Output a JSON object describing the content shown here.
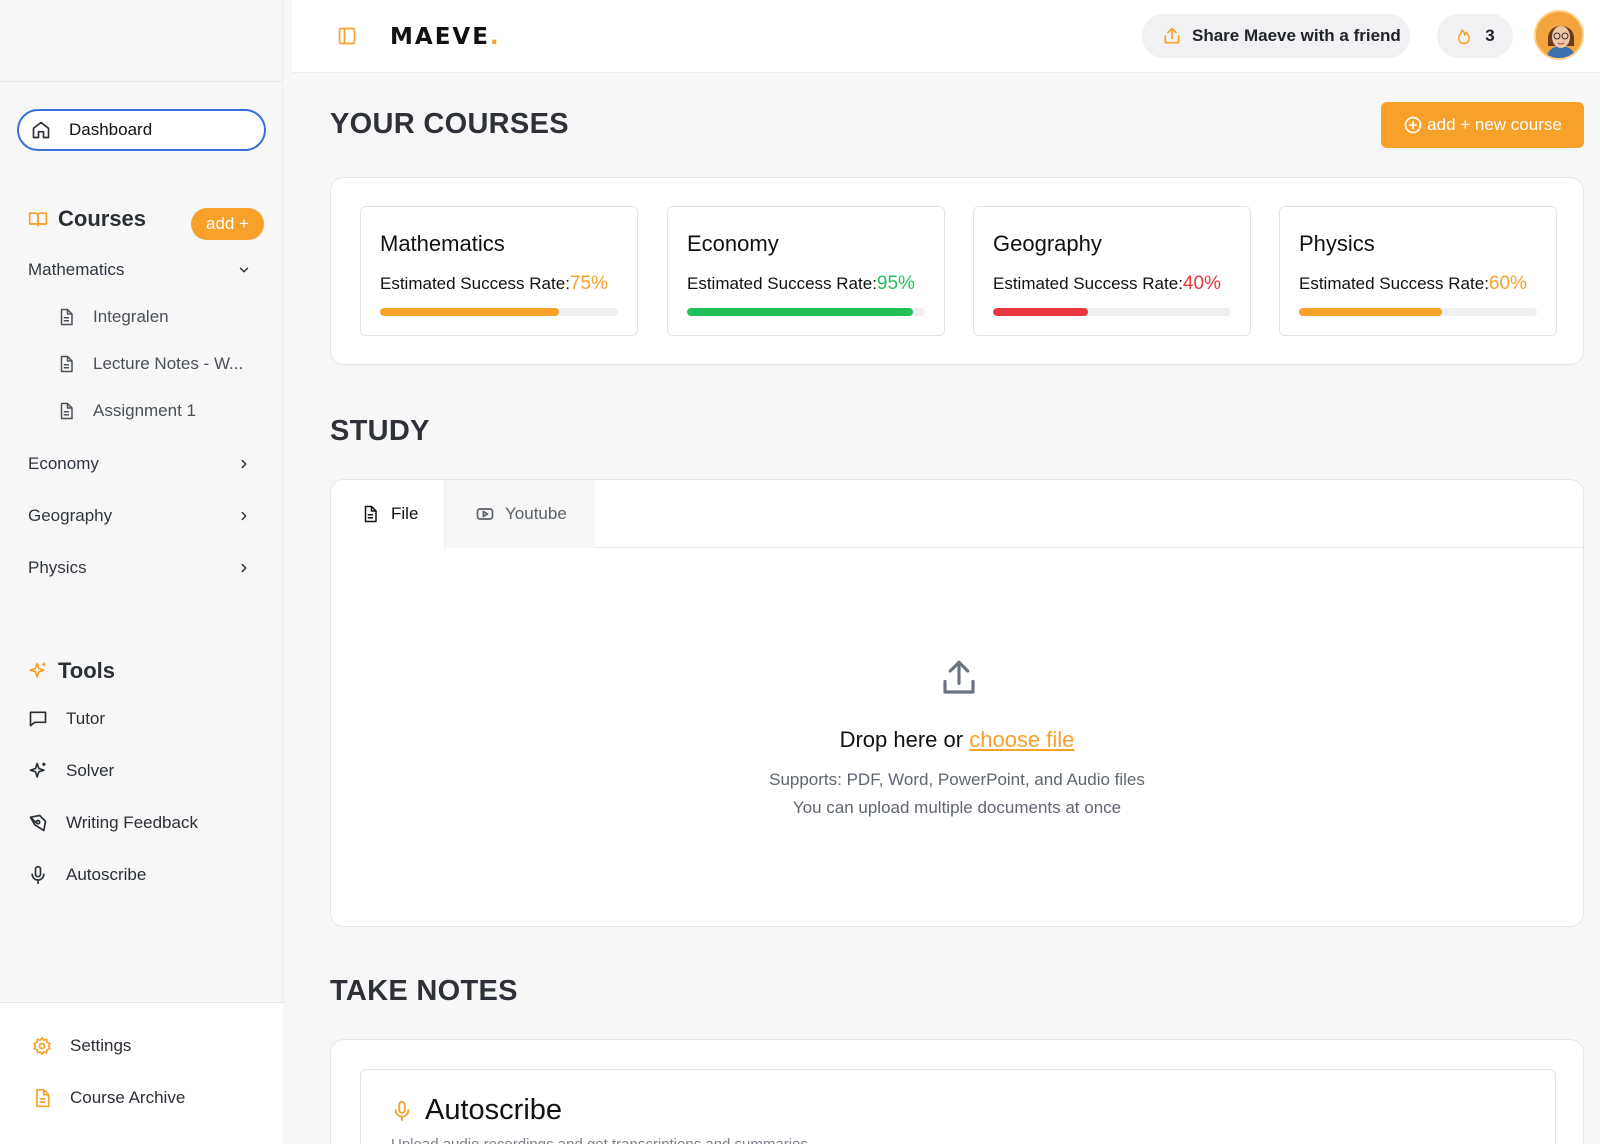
{
  "brand": {
    "name": "MAEVE",
    "dot": ".",
    "accent": "#f7a02a"
  },
  "topbar": {
    "share_label": "Share Maeve with a friend",
    "streak_count": "3"
  },
  "sidebar": {
    "dashboard_label": "Dashboard",
    "courses_heading": "Courses",
    "add_label": "add +",
    "courses": [
      {
        "label": "Mathematics",
        "expanded": true,
        "items": [
          "Integralen",
          "Lecture Notes - W...",
          "Assignment 1"
        ]
      },
      {
        "label": "Economy",
        "expanded": false
      },
      {
        "label": "Geography",
        "expanded": false
      },
      {
        "label": "Physics",
        "expanded": false
      }
    ],
    "tools_heading": "Tools",
    "tools": [
      "Tutor",
      "Solver",
      "Writing Feedback",
      "Autoscribe"
    ],
    "bottom": [
      "Settings",
      "Course Archive"
    ]
  },
  "main": {
    "courses_title": "YOUR COURSES",
    "new_course_label": "add + new course",
    "course_cards": [
      {
        "title": "Mathematics",
        "rate_label": "Estimated Success Rate:",
        "rate_text": "75%",
        "rate": 0.75,
        "color": "#f7a02a"
      },
      {
        "title": "Economy",
        "rate_label": "Estimated Success Rate:",
        "rate_text": "95%",
        "rate": 0.95,
        "color": "#22c05a"
      },
      {
        "title": "Geography",
        "rate_label": "Estimated Success Rate:",
        "rate_text": "40%",
        "rate": 0.4,
        "color": "#e8383e"
      },
      {
        "title": "Physics",
        "rate_label": "Estimated Success Rate:",
        "rate_text": "60%",
        "rate": 0.6,
        "color": "#f7a02a"
      }
    ],
    "study_title": "STUDY",
    "tabs": {
      "file": "File",
      "youtube": "Youtube"
    },
    "upload": {
      "drop_text": "Drop here or",
      "choose_link": "choose file",
      "supports": "Supports: PDF, Word, PowerPoint, and Audio files",
      "multiple": "You can upload multiple documents at once"
    },
    "notes_title": "TAKE NOTES",
    "autoscribe": {
      "title": "Autoscribe",
      "subtitle": "Upload audio recordings and get transcriptions and summaries"
    }
  }
}
